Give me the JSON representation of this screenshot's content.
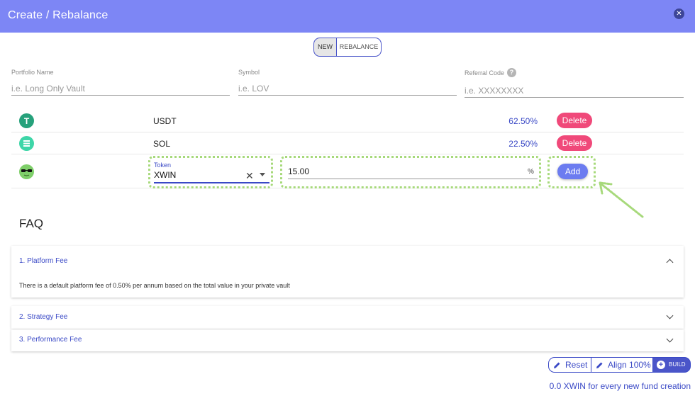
{
  "header": {
    "title": "Create / Rebalance"
  },
  "toggle": {
    "new_label": "NEW",
    "rebalance_label": "REBALANCE"
  },
  "form": {
    "portfolio_name": {
      "label": "Portfolio Name",
      "placeholder": "i.e. Long Only Vault"
    },
    "symbol": {
      "label": "Symbol",
      "placeholder": "i.e. LOV"
    },
    "referral_code": {
      "label": "Referral Code",
      "placeholder": "i.e. XXXXXXXX",
      "help_glyph": "?"
    }
  },
  "tokens": [
    {
      "name": "USDT",
      "percent": "62.50%",
      "delete_label": "Delete",
      "icon": "usdt-icon"
    },
    {
      "name": "SOL",
      "percent": "22.50%",
      "delete_label": "Delete",
      "icon": "sol-icon"
    }
  ],
  "new_token": {
    "select_label": "Token",
    "selected": "XWIN",
    "amount": "15.00",
    "unit": "%",
    "add_label": "Add",
    "icon": "xwin-icon"
  },
  "faq": {
    "title": "FAQ",
    "items": [
      {
        "question": "1. Platform Fee",
        "answer": "There is a default platform fee of 0.50% per annum based on the total value in your private vault",
        "expanded": true
      },
      {
        "question": "2. Strategy Fee",
        "expanded": false
      },
      {
        "question": "3. Performance Fee",
        "expanded": false
      }
    ]
  },
  "footer": {
    "reset_label": "Reset",
    "align_label": "Align 100%",
    "build_label": "BUILD",
    "note": "0.0 XWIN for every new fund creation"
  },
  "colors": {
    "header": "#7d86f5",
    "accent": "#3a49c6",
    "delete": "#f0497a",
    "add": "#6c7cf0",
    "highlight": "#a7d97b"
  }
}
